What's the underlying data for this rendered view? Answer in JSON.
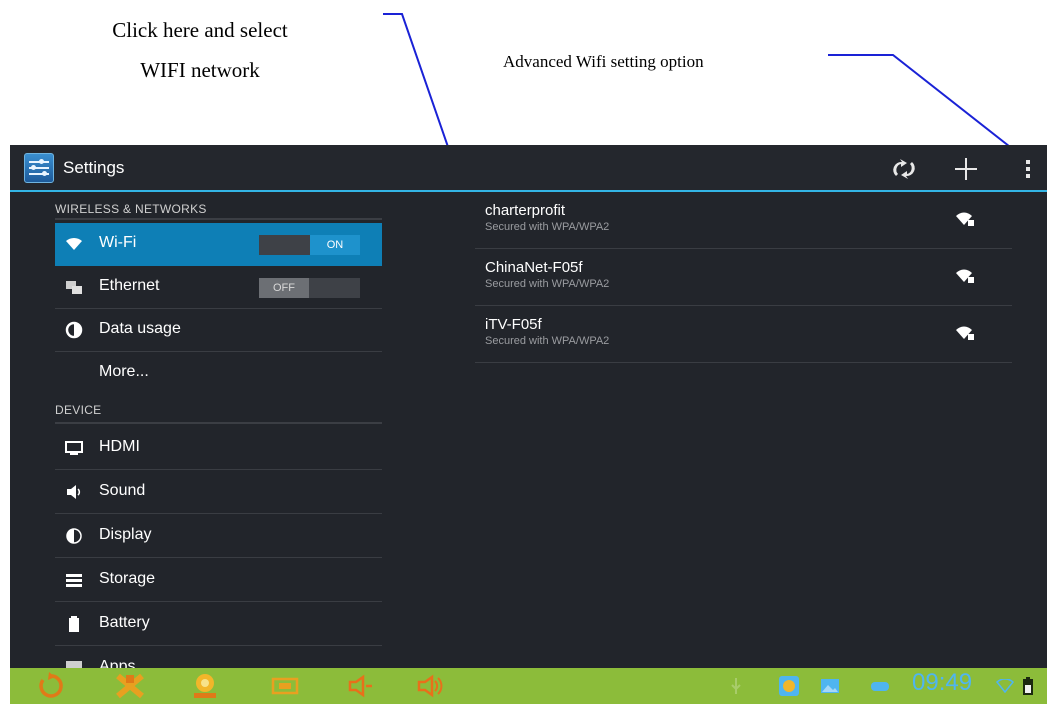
{
  "annotations": {
    "select_wifi_line1": "Click here and select",
    "select_wifi_line2": "WIFI network",
    "advanced_option": "Advanced Wifi setting option"
  },
  "action_bar": {
    "title": "Settings",
    "icons": [
      "settings-app-icon",
      "refresh-icon",
      "add-icon",
      "overflow-menu-icon"
    ],
    "accent_color": "#33b5e5"
  },
  "sidebar": {
    "section_wireless": "WIRELESS & NETWORKS",
    "section_device": "DEVICE",
    "items": [
      {
        "label": "Wi-Fi",
        "icon": "wifi-icon",
        "toggle": "ON",
        "selected": true
      },
      {
        "label": "Ethernet",
        "icon": "ethernet-icon",
        "toggle": "OFF"
      },
      {
        "label": "Data usage",
        "icon": "data-usage-icon"
      },
      {
        "label": "More...",
        "icon": ""
      },
      {
        "label": "HDMI",
        "icon": "monitor-icon"
      },
      {
        "label": "Sound",
        "icon": "speaker-icon"
      },
      {
        "label": "Display",
        "icon": "display-icon"
      },
      {
        "label": "Storage",
        "icon": "storage-icon"
      },
      {
        "label": "Battery",
        "icon": "battery-icon"
      },
      {
        "label": "Apps",
        "icon": "apps-icon"
      }
    ],
    "selected_color": "#0e7fb6"
  },
  "networks": [
    {
      "ssid": "charterprofit",
      "security": "Secured with WPA/WPA2",
      "icon": "wifi-signal-locked-icon"
    },
    {
      "ssid": "ChinaNet-F05f",
      "security": "Secured with WPA/WPA2",
      "icon": "wifi-signal-locked-icon"
    },
    {
      "ssid": "iTV-F05f",
      "security": "Secured with WPA/WPA2",
      "icon": "wifi-signal-locked-icon"
    }
  ],
  "status_bar": {
    "time": "09:49",
    "background": "#8cbc3a",
    "icons": [
      "back-icon",
      "home-icon",
      "recent-apps-icon",
      "screenshot-icon",
      "volume-down-icon",
      "volume-up-icon",
      "usb-icon",
      "app-notification-icon",
      "image-icon",
      "game-controller-icon",
      "wifi-status-icon",
      "battery-status-icon"
    ]
  }
}
